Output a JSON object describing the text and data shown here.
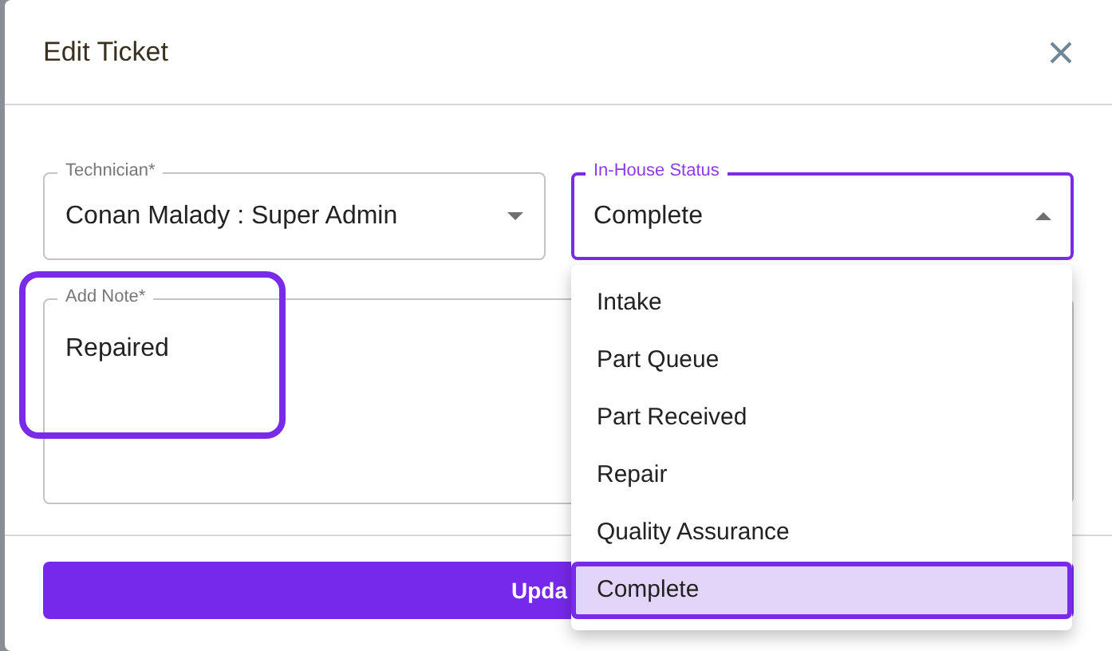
{
  "dialog": {
    "title": "Edit Ticket"
  },
  "fields": [
    {
      "label": "Technician*",
      "value": "Conan Malady : Super Admin",
      "focused": false,
      "expanded": false
    },
    {
      "label": "In-House Status",
      "value": "Complete",
      "focused": true,
      "expanded": true
    }
  ],
  "note": {
    "label": "Add Note*",
    "value": "Repaired",
    "highlighted": true
  },
  "dropdown": {
    "options": [
      {
        "label": "Intake",
        "selected": false
      },
      {
        "label": "Part Queue",
        "selected": false
      },
      {
        "label": "Part Received",
        "selected": false
      },
      {
        "label": "Repair",
        "selected": false
      },
      {
        "label": "Quality Assurance",
        "selected": false
      },
      {
        "label": "Complete",
        "selected": true
      }
    ]
  },
  "submit_button": "Upda"
}
